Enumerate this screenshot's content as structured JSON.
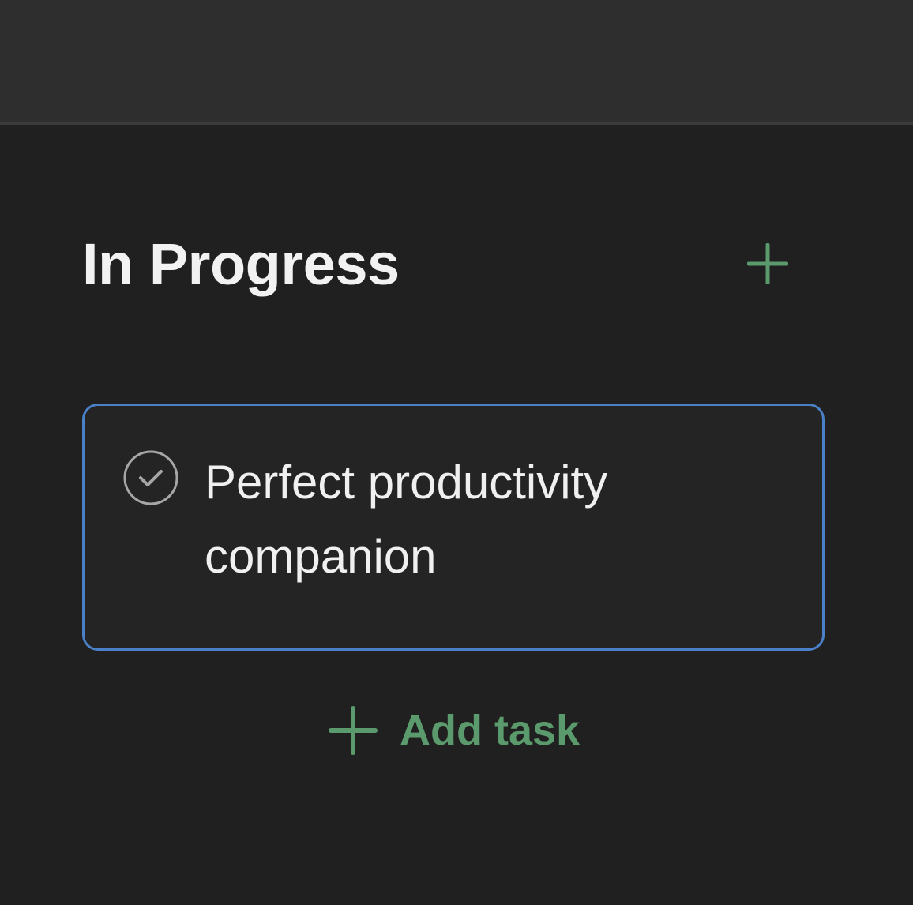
{
  "column": {
    "title": "In Progress",
    "add_icon": "plus-icon"
  },
  "tasks": [
    {
      "text": "Perfect productivity companion",
      "check_icon": "check-circle-icon"
    }
  ],
  "add_task": {
    "label": "Add task",
    "icon": "plus-icon"
  },
  "colors": {
    "background": "#202020",
    "topbar": "#2e2e2e",
    "accent_green": "#5a9a6c",
    "selected_border": "#4a80c8",
    "text": "#f0f0f0"
  }
}
